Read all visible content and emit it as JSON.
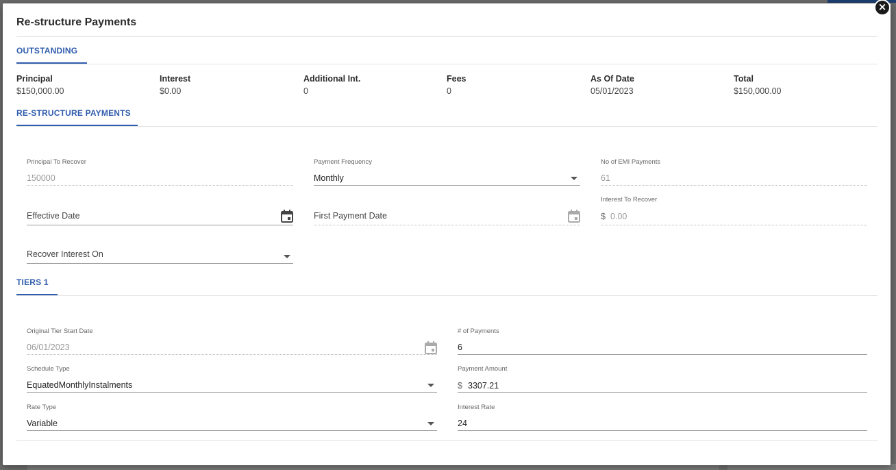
{
  "modal": {
    "title": "Re-structure Payments",
    "close_label": "×"
  },
  "outstanding": {
    "tab_label": "OUTSTANDING",
    "items": [
      {
        "label": "Principal",
        "value": "$150,000.00"
      },
      {
        "label": "Interest",
        "value": "$0.00"
      },
      {
        "label": "Additional Int.",
        "value": "0"
      },
      {
        "label": "Fees",
        "value": "0"
      },
      {
        "label": "As Of Date",
        "value": "05/01/2023"
      },
      {
        "label": "Total",
        "value": "$150,000.00"
      }
    ]
  },
  "restructure": {
    "tab_label": "RE-STRUCTURE PAYMENTS",
    "principal_to_recover": {
      "label": "Principal To Recover",
      "value": "150000"
    },
    "payment_frequency": {
      "label": "Payment Frequency",
      "value": "Monthly"
    },
    "no_of_emi_payments": {
      "label": "No of EMI Payments",
      "value": "61"
    },
    "effective_date": {
      "placeholder": "Effective Date"
    },
    "first_payment_date": {
      "placeholder": "First Payment Date"
    },
    "interest_to_recover": {
      "label": "Interest To Recover",
      "currency": "$",
      "value": "0.00"
    },
    "recover_interest_on": {
      "placeholder": "Recover Interest On"
    }
  },
  "tiers": {
    "tab_label": "TIERS 1",
    "original_tier_start_date": {
      "label": "Original Tier Start Date",
      "value": "06/01/2023"
    },
    "num_payments": {
      "label": "# of Payments",
      "value": "6"
    },
    "schedule_type": {
      "label": "Schedule Type",
      "value": "EquatedMonthlyInstalments"
    },
    "payment_amount": {
      "label": "Payment Amount",
      "currency": "$",
      "value": "3307.21"
    },
    "rate_type": {
      "label": "Rate Type",
      "value": "Variable"
    },
    "interest_rate": {
      "label": "Interest Rate",
      "value": "24"
    }
  },
  "colors": {
    "accent": "#2f5cad",
    "title": "#2c2c2c",
    "backdrop": "#6b6b6b"
  },
  "icons": {
    "calendar": "calendar-icon",
    "dropdown": "chevron-down-icon",
    "close": "close-icon"
  }
}
